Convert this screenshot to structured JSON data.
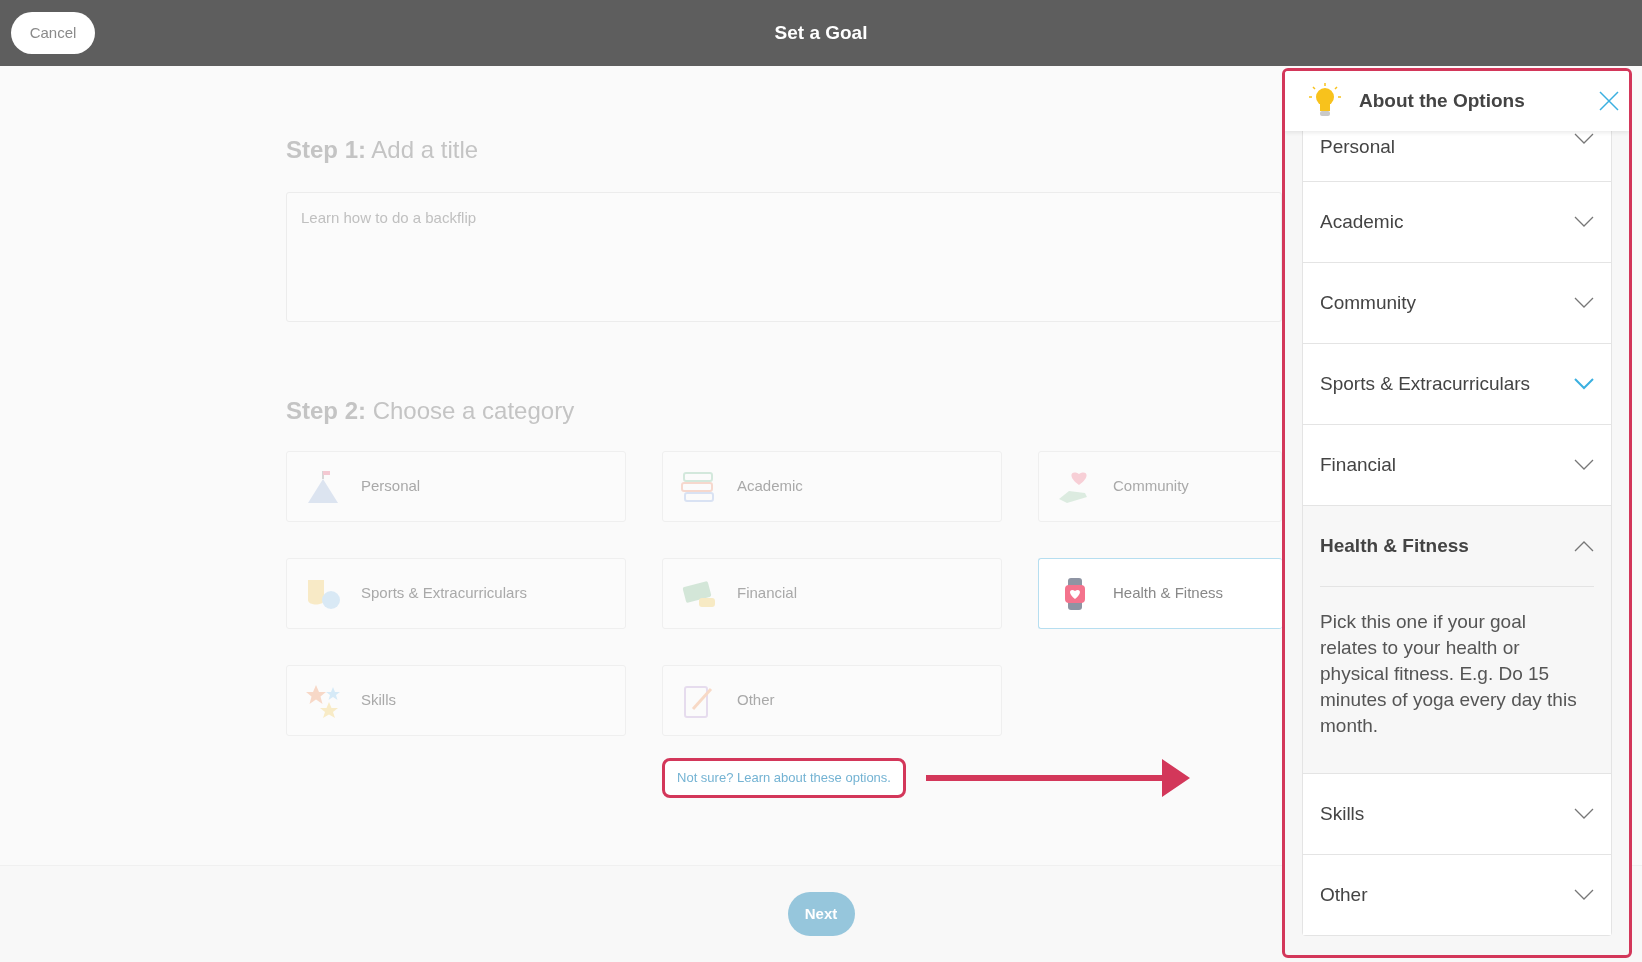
{
  "header": {
    "cancel": "Cancel",
    "title": "Set a Goal"
  },
  "step1": {
    "label": "Step 1:",
    "title": "Add a title",
    "placeholder": "Learn how to do a backflip"
  },
  "step2": {
    "label": "Step 2:",
    "title": "Choose a category",
    "categories": [
      {
        "label": "Personal",
        "kind": "mountain",
        "selected": false
      },
      {
        "label": "Academic",
        "kind": "books",
        "selected": false
      },
      {
        "label": "Community",
        "kind": "heart",
        "selected": false
      },
      {
        "label": "Sports & Extracurriculars",
        "kind": "masks",
        "selected": false
      },
      {
        "label": "Financial",
        "kind": "money",
        "selected": false
      },
      {
        "label": "Health & Fitness",
        "kind": "watch",
        "selected": true
      },
      {
        "label": "Skills",
        "kind": "stars",
        "selected": false
      },
      {
        "label": "Other",
        "kind": "notepad",
        "selected": false
      }
    ]
  },
  "help_link": "Not sure? Learn about these options.",
  "next": "Next",
  "panel": {
    "title": "About the Options",
    "items": [
      {
        "label": "Personal",
        "expanded": false,
        "highlighted": false
      },
      {
        "label": "Academic",
        "expanded": false,
        "highlighted": false
      },
      {
        "label": "Community",
        "expanded": false,
        "highlighted": false
      },
      {
        "label": "Sports & Extracurriculars",
        "expanded": false,
        "highlighted": true
      },
      {
        "label": "Financial",
        "expanded": false,
        "highlighted": false
      },
      {
        "label": "Health & Fitness",
        "expanded": true,
        "highlighted": false,
        "description": "Pick this one if your goal relates to your health or physical fitness. E.g. Do 15 minutes of yoga every day this month."
      },
      {
        "label": "Skills",
        "expanded": false,
        "highlighted": false
      },
      {
        "label": "Other",
        "expanded": false,
        "highlighted": false
      }
    ]
  }
}
